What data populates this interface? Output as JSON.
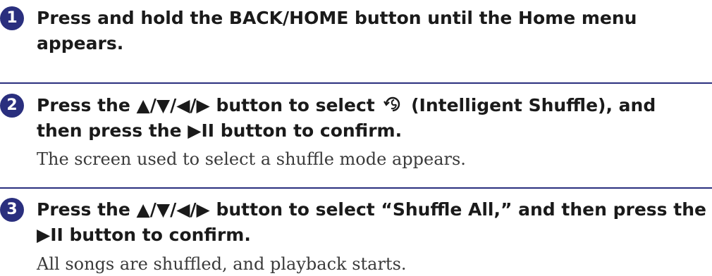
{
  "steps": [
    {
      "number": "1",
      "instruction": "Press and hold the BACK/HOME button until the Home menu appears.",
      "result": ""
    },
    {
      "number": "2",
      "instruction_before_icon": "Press the ▲/▼/◀/▶ button to select ",
      "icon": "intelligent-shuffle-icon",
      "instruction_after_icon": " (Intelligent Shuffle), and then press the ▶II button to confirm.",
      "result": "The screen used to select a shuffle mode appears."
    },
    {
      "number": "3",
      "instruction": "Press the ▲/▼/◀/▶ button to select “Shuffle All,” and then press the ▶II button to confirm.",
      "result": "All songs are shuffled, and playback starts."
    }
  ],
  "colors": {
    "accent": "#2a2f7e",
    "text": "#1a1a1a",
    "result_text": "#3a3a3a"
  }
}
